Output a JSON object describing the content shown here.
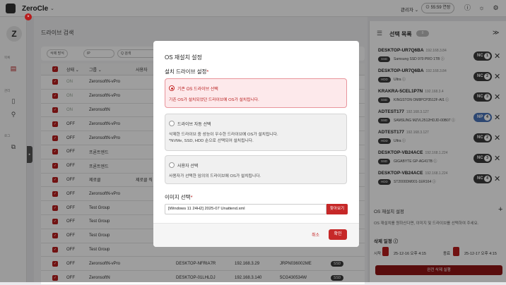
{
  "topbar": {
    "brand": "ZeroCle",
    "brand_caret": "⌄",
    "admin": "관리자 ⌄",
    "timer": "⊙ 55:59 연장"
  },
  "sidebar": {
    "logo": "Z",
    "close": "×",
    "section1": "목록",
    "section2": "관리",
    "section3": "로그",
    "handle": "▸"
  },
  "main": {
    "title": "드라이브 검색",
    "filters": {
      "bulk": "삭제 방식",
      "field": "IP",
      "search": "Q 검색"
    },
    "headers": {
      "status": "상태 ⌄",
      "group": "그룹 ⌄",
      "user": "사용자"
    },
    "rows": [
      {
        "status": "ON",
        "group": "ZeronsoftN-vPro",
        "user": "",
        "name": "",
        "ip": "",
        "serial": "",
        "chip": ""
      },
      {
        "status": "ON",
        "group": "ZeronsoftN-vPro",
        "user": "",
        "name": "",
        "ip": "",
        "serial": "",
        "chip": ""
      },
      {
        "status": "ON",
        "group": "ZeronsoftN",
        "user": "",
        "name": "",
        "ip": "",
        "serial": "",
        "chip": ""
      },
      {
        "status": "OFF",
        "group": "ZeronsoftN-vPro",
        "user": "",
        "name": "",
        "ip": "",
        "serial": "",
        "chip": ""
      },
      {
        "status": "OFF",
        "group": "ZeronsoftN-vPro",
        "user": "",
        "name": "",
        "ip": "",
        "serial": "",
        "chip": ""
      },
      {
        "status": "OFF",
        "group": "프론트엔드",
        "user": "",
        "name": "",
        "ip": "",
        "serial": "",
        "chip": ""
      },
      {
        "status": "OFF",
        "group": "프론트엔드",
        "user": "",
        "name": "",
        "ip": "",
        "serial": "",
        "chip": ""
      },
      {
        "status": "OFF",
        "group": "제로클",
        "user": "제로클 직",
        "name": "",
        "ip": "",
        "serial": "",
        "chip": ""
      },
      {
        "status": "OFF",
        "group": "ZeronsoftN-vPro",
        "user": "",
        "name": "",
        "ip": "",
        "serial": "",
        "chip": ""
      },
      {
        "status": "OFF",
        "group": "Test Group",
        "user": "",
        "name": "",
        "ip": "",
        "serial": "",
        "chip": ""
      },
      {
        "status": "OFF",
        "group": "Test Group",
        "user": "",
        "name": "",
        "ip": "",
        "serial": "",
        "chip": ""
      },
      {
        "status": "OFF",
        "group": "Test Group",
        "user": "",
        "name": "",
        "ip": "",
        "serial": "",
        "chip": ""
      },
      {
        "status": "OFF",
        "group": "Test Group",
        "user": "",
        "name": "",
        "ip": "",
        "serial": "",
        "chip": ""
      },
      {
        "status": "OFF",
        "group": "ZeronsoftN-vPro",
        "user": "",
        "name": "DESKTOP-NFRIA7R",
        "ip": "192.168.3.29",
        "serial": "JRPN036002ME",
        "chip": "SSD"
      },
      {
        "status": "OFF",
        "group": "ZeronsoftN",
        "user": "",
        "name": "DESKTOP-01LHLDJ",
        "ip": "192.168.3.140",
        "serial": "5CG430534W",
        "chip": "SSD"
      }
    ]
  },
  "right_panel": {
    "title": "선택 목록",
    "count": "8",
    "collapse": "≫",
    "items": [
      {
        "name": "DESKTOP-UR7Q6BA",
        "ip": "192.168.3.84",
        "chip": "SSD",
        "disk": "Samsung SSD 970 PRO 1TB ⓘ",
        "nc": "NC",
        "num": "1",
        "blue": false
      },
      {
        "name": "DESKTOP-UR7Q6BA",
        "ip": "192.168.3.84",
        "chip": "HDD",
        "disk": "Ultra ⓘ",
        "nc": "NC",
        "num": "2",
        "blue": false
      },
      {
        "name": "KRAKRA-5CEL1P7N",
        "ip": "192.168.3.4",
        "chip": "SSD",
        "disk": "KINGSTON OM8PCP3512F-AI1 ⓘ",
        "nc": "NC",
        "num": "3",
        "blue": false
      },
      {
        "name": "ADTEST177",
        "ip": "192.168.3.127",
        "chip": "SSD",
        "disk": "SAMSUNG MZVL2512HDJD-00B07 ⓘ",
        "nc": "NP",
        "num": "4",
        "blue": true
      },
      {
        "name": "ADTEST177",
        "ip": "192.168.3.127",
        "chip": "HDD",
        "disk": "Ultra ⓘ",
        "nc": "NC",
        "num": "2",
        "blue": false
      },
      {
        "name": "DESKTOP-VB24ACE",
        "ip": "192.168.1.224",
        "chip": "SSD",
        "disk": "GIGABYTE GP-AG41TB ⓘ",
        "nc": "NC",
        "num": "3",
        "blue": false
      },
      {
        "name": "DESKTOP-VB24ACE",
        "ip": "192.168.1.224",
        "chip": "HDD",
        "disk": "ST2000DM001-1ER164 ⓘ",
        "nc": "NC",
        "num": "4",
        "blue": false
      }
    ],
    "os_section": "OS 재설치 설정",
    "os_add": "+",
    "os_desc": "OS 재설치를 원하신다면, 이미지 및 드라이브를 선택하여 주세요.",
    "schedule": "삭제 일정 ⓘ",
    "start_label": "시작",
    "start_value": "25-12-16 오후 4:15",
    "end_label": "종료",
    "end_value": "25-12-17 오후 4:15",
    "execute": "완전 삭제 실행"
  },
  "modal": {
    "title": "OS 재설치 설정",
    "section": "설치 드라이브 설정",
    "req": "*",
    "options": [
      {
        "label": "기존 OS 드라이브 선택",
        "desc1": "기존 OS가 설치되었던 드라이브에 OS가 설치됩니다.",
        "desc2": ""
      },
      {
        "label": "드라이브 자동 선택",
        "desc1": "삭제한 드라이브 중 성능이 우수한 드라이브에 OS가 설치됩니다.",
        "desc2": "*NVMe, SSD, HDD 순으로 선택되어 설치됩니다."
      },
      {
        "label": "사용자 선택",
        "desc1": "사용자가 선택한 임의의 드라이브에 OS가 설치됩니다.",
        "desc2": ""
      }
    ],
    "image_label": "이미지 선택",
    "image_value": "[Windows 11 24H2] 2025-07 Unattend.xml",
    "browse": "찾아보기",
    "cancel": "취소",
    "ok": "확인"
  }
}
